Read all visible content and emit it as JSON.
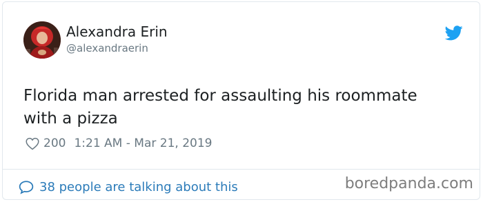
{
  "tweet": {
    "display_name": "Alexandra Erin",
    "handle": "@alexandraerin",
    "text": "Florida man arrested for assaulting his roommate with a pizza",
    "likes": "200",
    "timestamp": "1:21 AM - Mar 21, 2019",
    "conversation_label": "38 people are talking about this"
  },
  "icons": {
    "platform": "twitter-bird-icon",
    "like": "heart-icon",
    "reply": "speech-bubble-icon"
  },
  "colors": {
    "twitter_blue": "#1da1f2",
    "link_blue": "#2b7bb9",
    "meta_gray": "#697882",
    "text_dark": "#1c2022",
    "border": "#e1e8ed"
  },
  "watermark": "boredpanda.com"
}
